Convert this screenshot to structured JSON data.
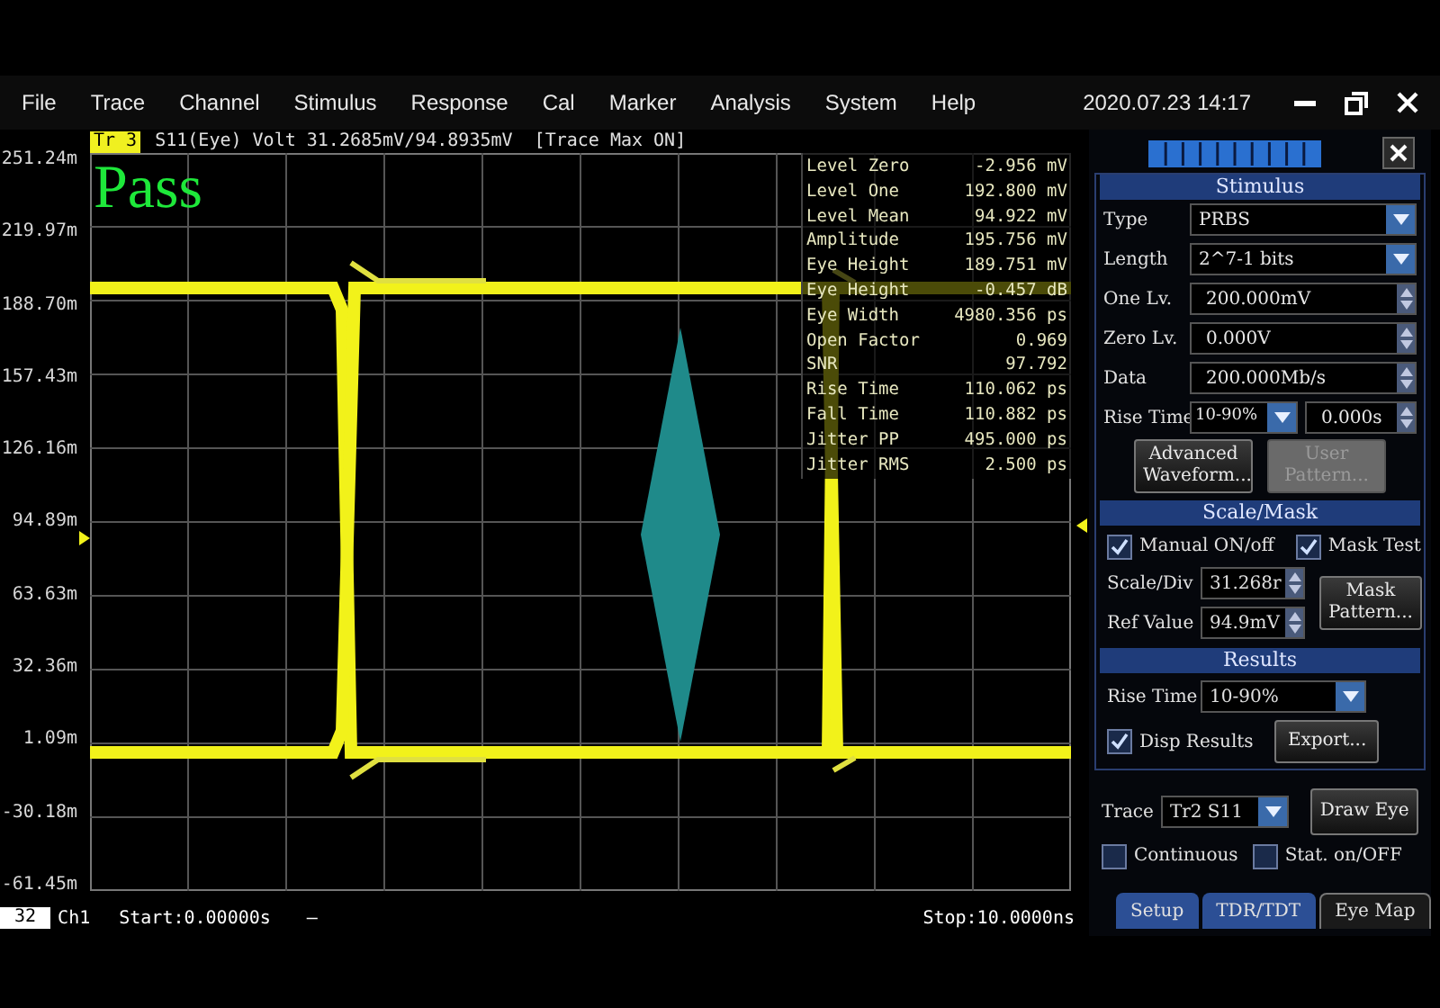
{
  "menu": [
    "File",
    "Trace",
    "Channel",
    "Stimulus",
    "Response",
    "Cal",
    "Marker",
    "Analysis",
    "System",
    "Help"
  ],
  "datetime": "2020.07.23 14:17",
  "trace_header": {
    "badge": "Tr 3",
    "text": "S11(Eye) Volt 31.2685mV/94.8935mV  [Trace Max ON]"
  },
  "y_axis": [
    "251.24m",
    "219.97m",
    "188.70m",
    "157.43m",
    "126.16m",
    "94.89m",
    "63.63m",
    "32.36m",
    "1.09m",
    "-30.18m",
    "-61.45m"
  ],
  "verdict": {
    "text": "Pass",
    "passed": true
  },
  "measurements": [
    {
      "label": "Level Zero",
      "value": "-2.956 mV"
    },
    {
      "label": "Level One",
      "value": "192.800 mV"
    },
    {
      "label": "Level Mean",
      "value": "94.922 mV"
    },
    {
      "label": "Amplitude",
      "value": "195.756 mV"
    },
    {
      "label": "Eye Height",
      "value": "189.751 mV"
    },
    {
      "label": "Eye Height",
      "value": "-0.457 dB"
    },
    {
      "label": "Eye Width",
      "value": "4980.356 ps"
    },
    {
      "label": "Open Factor",
      "value": "0.969"
    },
    {
      "label": "SNR",
      "value": "97.792"
    },
    {
      "label": "Rise Time",
      "value": "110.062 ps"
    },
    {
      "label": "Fall Time",
      "value": "110.882 ps"
    },
    {
      "label": "Jitter PP",
      "value": "495.000 ps"
    },
    {
      "label": "Jitter RMS",
      "value": "2.500 ps"
    }
  ],
  "status_bar": {
    "channel_number": "32",
    "channel": "Ch1",
    "start": "Start:0.00000s",
    "marker": "—",
    "stop": "Stop:10.0000ns"
  },
  "stimulus": {
    "title": "Stimulus",
    "fields": [
      {
        "label": "Type",
        "kind": "dropdown",
        "value": "PRBS"
      },
      {
        "label": "Length",
        "kind": "dropdown",
        "value": "2^7-1 bits"
      },
      {
        "label": "One Lv.",
        "kind": "spin",
        "value": "200.000mV"
      },
      {
        "label": "Zero Lv.",
        "kind": "spin",
        "value": "0.000V"
      },
      {
        "label": "Data",
        "kind": "spin",
        "value": "200.000Mb/s"
      },
      {
        "label": "Rise Time",
        "kind": "dropdown_spin",
        "value": "10-90%",
        "value2": "0.000s"
      }
    ],
    "buttons": [
      {
        "label": "Advanced Waveform...",
        "disabled": false
      },
      {
        "label": "User Pattern...",
        "disabled": true
      }
    ]
  },
  "scale_mask": {
    "title": "Scale/Mask",
    "checkboxes": [
      {
        "label": "Manual ON/off",
        "checked": true
      },
      {
        "label": "Mask Test",
        "checked": true
      }
    ],
    "fields": [
      {
        "label": "Scale/Div",
        "value": "31.268r"
      },
      {
        "label": "Ref Value",
        "value": "94.9mV"
      }
    ],
    "button": "Mask Pattern..."
  },
  "results": {
    "title": "Results",
    "rise_time": {
      "label": "Rise Time",
      "value": "10-90%"
    },
    "checkbox": {
      "label": "Disp Results",
      "checked": true
    },
    "button": "Export..."
  },
  "trace": {
    "label": "Trace",
    "value": "Tr2 S11",
    "button": "Draw Eye"
  },
  "options": [
    {
      "label": "Continuous",
      "checked": false
    },
    {
      "label": "Stat. on/OFF",
      "checked": false
    }
  ],
  "tabs": [
    {
      "label": "Setup",
      "selected": false
    },
    {
      "label": "TDR/TDT",
      "selected": false
    },
    {
      "label": "Eye Map",
      "selected": true
    }
  ]
}
